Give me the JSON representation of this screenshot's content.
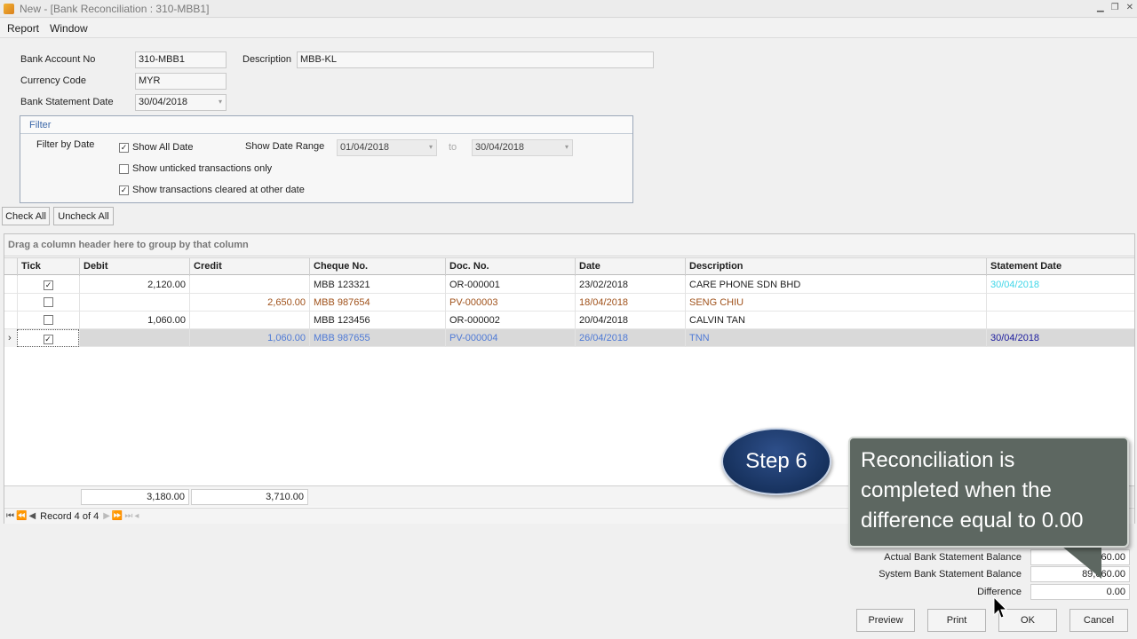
{
  "window": {
    "title": "New  - [Bank Reconciliation : 310-MBB1]"
  },
  "menu": [
    "Report",
    "Window"
  ],
  "header": {
    "bank_account_label": "Bank Account No",
    "bank_account_value": "310-MBB1",
    "description_label": "Description",
    "description_value": "MBB-KL",
    "currency_label": "Currency Code",
    "currency_value": "MYR",
    "statement_date_label": "Bank Statement Date",
    "statement_date_value": "30/04/2018"
  },
  "filter": {
    "title": "Filter",
    "filter_by_date_label": "Filter by Date",
    "show_all_date_label": "Show All Date",
    "show_all_date_checked": true,
    "show_date_range_label": "Show Date Range",
    "date_from": "01/04/2018",
    "to_label": "to",
    "date_to": "30/04/2018",
    "show_unticked_label": "Show unticked transactions only",
    "show_unticked_checked": false,
    "show_cleared_label": "Show transactions cleared at other date",
    "show_cleared_checked": true
  },
  "actions": {
    "check_all": "Check All",
    "uncheck_all": "Uncheck All"
  },
  "grid": {
    "group_hint": "Drag a column header here to group by that column",
    "columns": [
      "Tick",
      "Debit",
      "Credit",
      "Cheque No.",
      "Doc. No.",
      "Date",
      "Description",
      "Statement Date"
    ],
    "rows": [
      {
        "tick": true,
        "debit": "2,120.00",
        "credit": "",
        "cheque": "MBB 123321",
        "doc": "OR-000001",
        "date": "23/02/2018",
        "desc": "CARE PHONE SDN BHD",
        "stmt": "30/04/2018"
      },
      {
        "tick": false,
        "debit": "",
        "credit": "2,650.00",
        "cheque": "MBB 987654",
        "doc": "PV-000003",
        "date": "18/04/2018",
        "desc": "SENG CHIU",
        "stmt": ""
      },
      {
        "tick": false,
        "debit": "1,060.00",
        "credit": "",
        "cheque": "MBB 123456",
        "doc": "OR-000002",
        "date": "20/04/2018",
        "desc": "CALVIN TAN",
        "stmt": ""
      },
      {
        "tick": true,
        "debit": "",
        "credit": "1,060.00",
        "cheque": "MBB 987655",
        "doc": "PV-000004",
        "date": "26/04/2018",
        "desc": "TNN",
        "stmt": "30/04/2018"
      }
    ],
    "total_debit": "3,180.00",
    "total_credit": "3,710.00",
    "record_text": "Record 4 of 4"
  },
  "summary": {
    "actual_label": "Actual Bank Statement Balance",
    "actual_value": "89,060.00",
    "system_label": "System Bank Statement Balance",
    "system_value": "89,060.00",
    "difference_label": "Difference",
    "difference_value": "0.00"
  },
  "buttons": {
    "preview": "Preview",
    "print": "Print",
    "ok": "OK",
    "cancel": "Cancel"
  },
  "overlay": {
    "step_label": "Step 6",
    "callout_text": "Reconciliation is completed when the difference equal to 0.00"
  }
}
